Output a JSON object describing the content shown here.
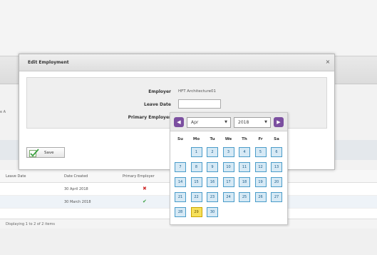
{
  "dialog": {
    "title": "Edit Employment",
    "close_glyph": "×",
    "employer_label": "Employer",
    "employer_value": "HFT Architecture01",
    "leave_date_label": "Leave Date",
    "leave_date_value": "",
    "primary_employer_label": "Primary Employer",
    "save_label": "Save"
  },
  "datepicker": {
    "prev_glyph": "◀",
    "next_glyph": "▶",
    "month": "Apr",
    "year": "2018",
    "weekdays": [
      "Su",
      "Mo",
      "Tu",
      "We",
      "Th",
      "Fr",
      "Sa"
    ],
    "days": [
      "1",
      "2",
      "3",
      "4",
      "5",
      "6",
      "7",
      "8",
      "9",
      "10",
      "11",
      "12",
      "13",
      "14",
      "15",
      "16",
      "17",
      "18",
      "19",
      "20",
      "21",
      "22",
      "23",
      "24",
      "25",
      "26",
      "27",
      "28",
      "29",
      "30"
    ],
    "first_weekday_index": 1,
    "selected_day": "29"
  },
  "background": {
    "side_label": "e A",
    "grid_headers": [
      "Leave Date",
      "Date Created",
      "Primary Employer"
    ],
    "rows": [
      {
        "date_created": "30 April 2018",
        "primary": "✖",
        "primary_color": "#d03030"
      },
      {
        "date_created": "30 March 2018",
        "primary": "✔",
        "primary_color": "#3aa040"
      }
    ],
    "pager_text": "Displaying 1 to 2 of 2 items"
  }
}
